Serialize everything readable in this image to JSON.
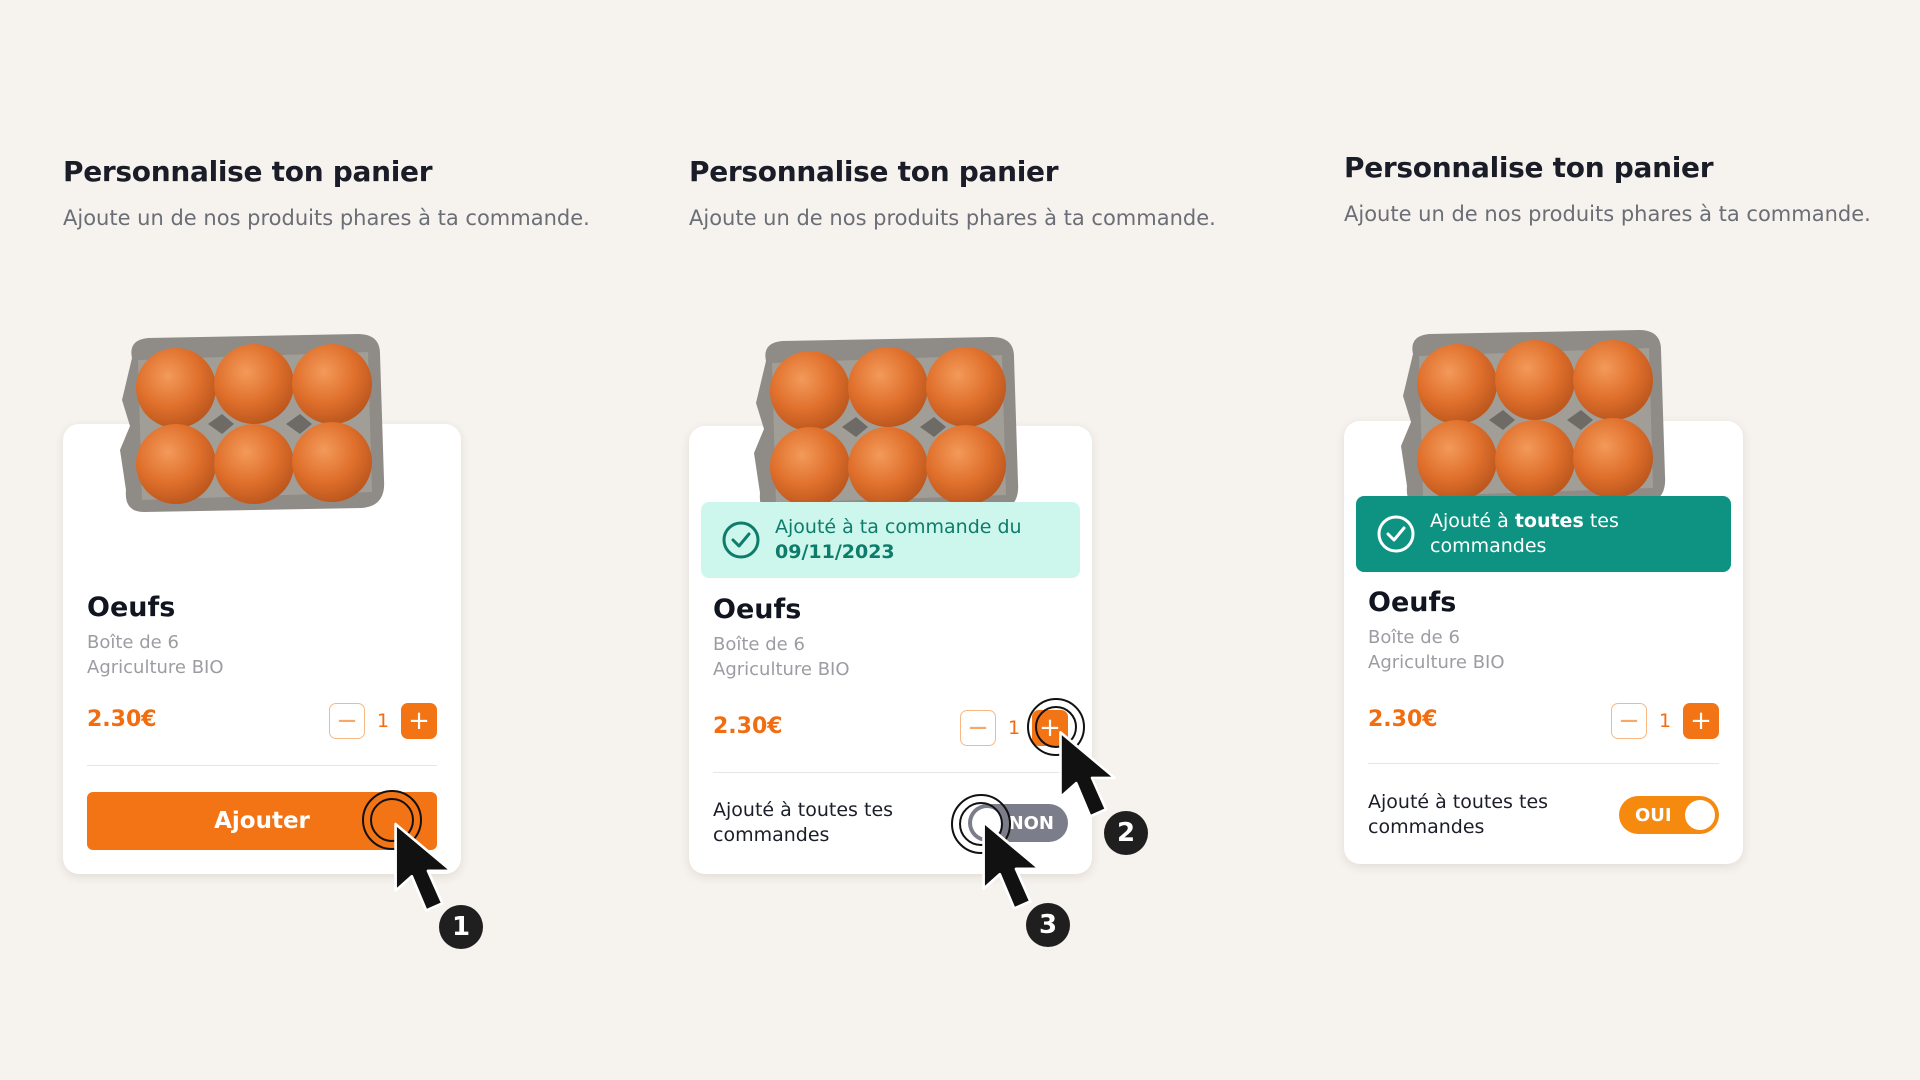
{
  "panels": [
    {
      "title": "Personnalise ton panier",
      "subtitle": "Ajoute un de nos produits phares à ta commande.",
      "product": {
        "name": "Oeufs",
        "desc_line1": "Boîte de 6",
        "desc_line2": "Agriculture BIO",
        "price": "2.30€",
        "quantity": "1"
      },
      "add_button": "Ajouter",
      "step": "1"
    },
    {
      "title": "Personnalise ton panier",
      "subtitle": "Ajoute un de nos produits phares à ta commande.",
      "badge": {
        "line1": "Ajouté à ta commande du",
        "line2": "09/11/2023"
      },
      "product": {
        "name": "Oeufs",
        "desc_line1": "Boîte de 6",
        "desc_line2": "Agriculture BIO",
        "price": "2.30€",
        "quantity": "1"
      },
      "subscription": {
        "label_line1": "Ajouté à toutes tes",
        "label_line2": "commandes",
        "toggle_text": "NON",
        "enabled": false
      },
      "steps": [
        "2",
        "3"
      ]
    },
    {
      "title": "Personnalise ton panier",
      "subtitle": "Ajoute un de nos produits phares à ta commande.",
      "badge": {
        "pre": "Ajouté à",
        "bold": "toutes",
        "post": "tes",
        "line2": "commandes"
      },
      "product": {
        "name": "Oeufs",
        "desc_line1": "Boîte de 6",
        "desc_line2": "Agriculture BIO",
        "price": "2.30€",
        "quantity": "1"
      },
      "subscription": {
        "label_line1": "Ajouté à toutes tes",
        "label_line2": "commandes",
        "toggle_text": "OUI",
        "enabled": true
      }
    }
  ],
  "icons": {
    "minus": "minus-icon",
    "plus": "plus-icon",
    "check": "check-circle-icon",
    "cursor": "mouse-pointer-icon"
  },
  "colors": {
    "accent": "#f37415",
    "price": "#f26d0f",
    "success_light": "#cdf6ec",
    "success_dark": "#0e9383",
    "toggle_off": "#7b7e8a",
    "toggle_on": "#f58a0f",
    "background": "#f6f2ee"
  }
}
